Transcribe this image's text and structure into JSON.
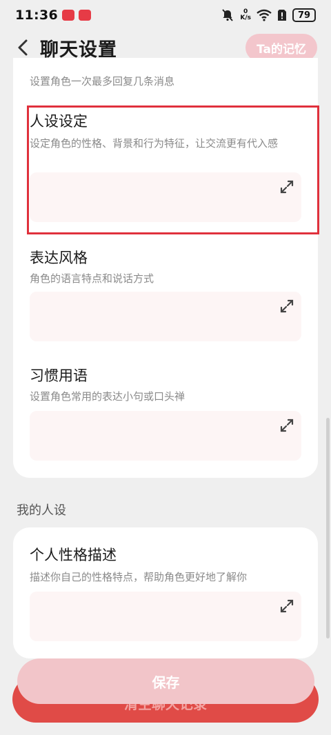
{
  "status_bar": {
    "time": "11:36",
    "net_speed_value": "0",
    "net_speed_unit": "K/s",
    "battery": "79"
  },
  "header": {
    "title": "聊天设置",
    "memory_button": "Ta的记忆"
  },
  "character_settings": {
    "reply_limit_desc": "设置角色一次最多回复几条消息",
    "persona": {
      "title": "人设设定",
      "desc": "设定角色的性格、背景和行为特征，让交流更有代入感"
    },
    "style": {
      "title": "表达风格",
      "desc": "角色的语言特点和说话方式"
    },
    "phrases": {
      "title": "习惯用语",
      "desc": "设置角色常用的表达小句或口头禅"
    }
  },
  "my_persona": {
    "section_label": "我的人设",
    "personality": {
      "title": "个人性格描述",
      "desc": "描述你自己的性格特点，帮助角色更好地了解你"
    }
  },
  "buttons": {
    "save": "保存",
    "clear_history": "清空聊天记录"
  },
  "colors": {
    "accent": "#e04b47",
    "accent_light": "#f2c5c9",
    "highlight": "#e0303c"
  }
}
